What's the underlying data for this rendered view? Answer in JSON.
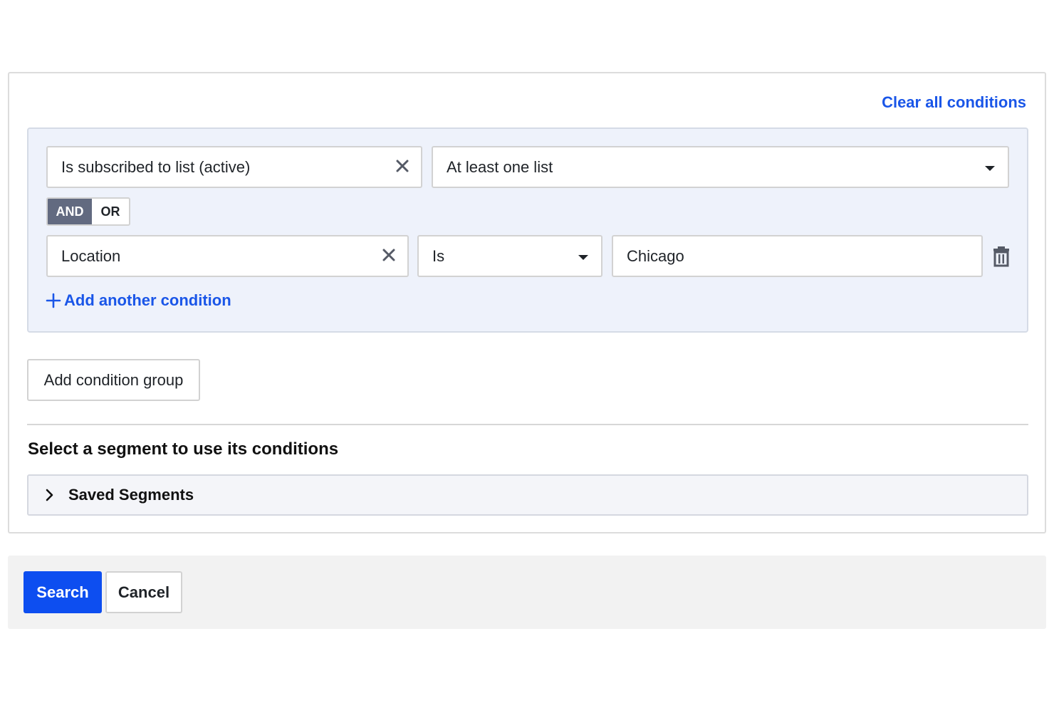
{
  "header": {
    "clear_all_label": "Clear all conditions"
  },
  "group": {
    "condition1": {
      "field_value": "Is subscribed to list (active)",
      "operator_value": "At least one list"
    },
    "logic": {
      "and_label": "AND",
      "or_label": "OR",
      "selected": "AND"
    },
    "condition2": {
      "field_value": "Location",
      "operator_value": "Is",
      "value": "Chicago"
    },
    "add_condition_label": "Add another condition"
  },
  "add_group_label": "Add condition group",
  "segments": {
    "heading": "Select a segment to use its conditions",
    "saved_label": "Saved Segments"
  },
  "footer": {
    "search_label": "Search",
    "cancel_label": "Cancel"
  },
  "colors": {
    "accent": "#1a56e8",
    "primary_button": "#0d4ef0",
    "group_bg": "#eef2fb",
    "toggle_on": "#626a80"
  },
  "icons": [
    "close-icon",
    "caret-down-icon",
    "trash-icon",
    "plus-icon",
    "chevron-right-icon"
  ]
}
